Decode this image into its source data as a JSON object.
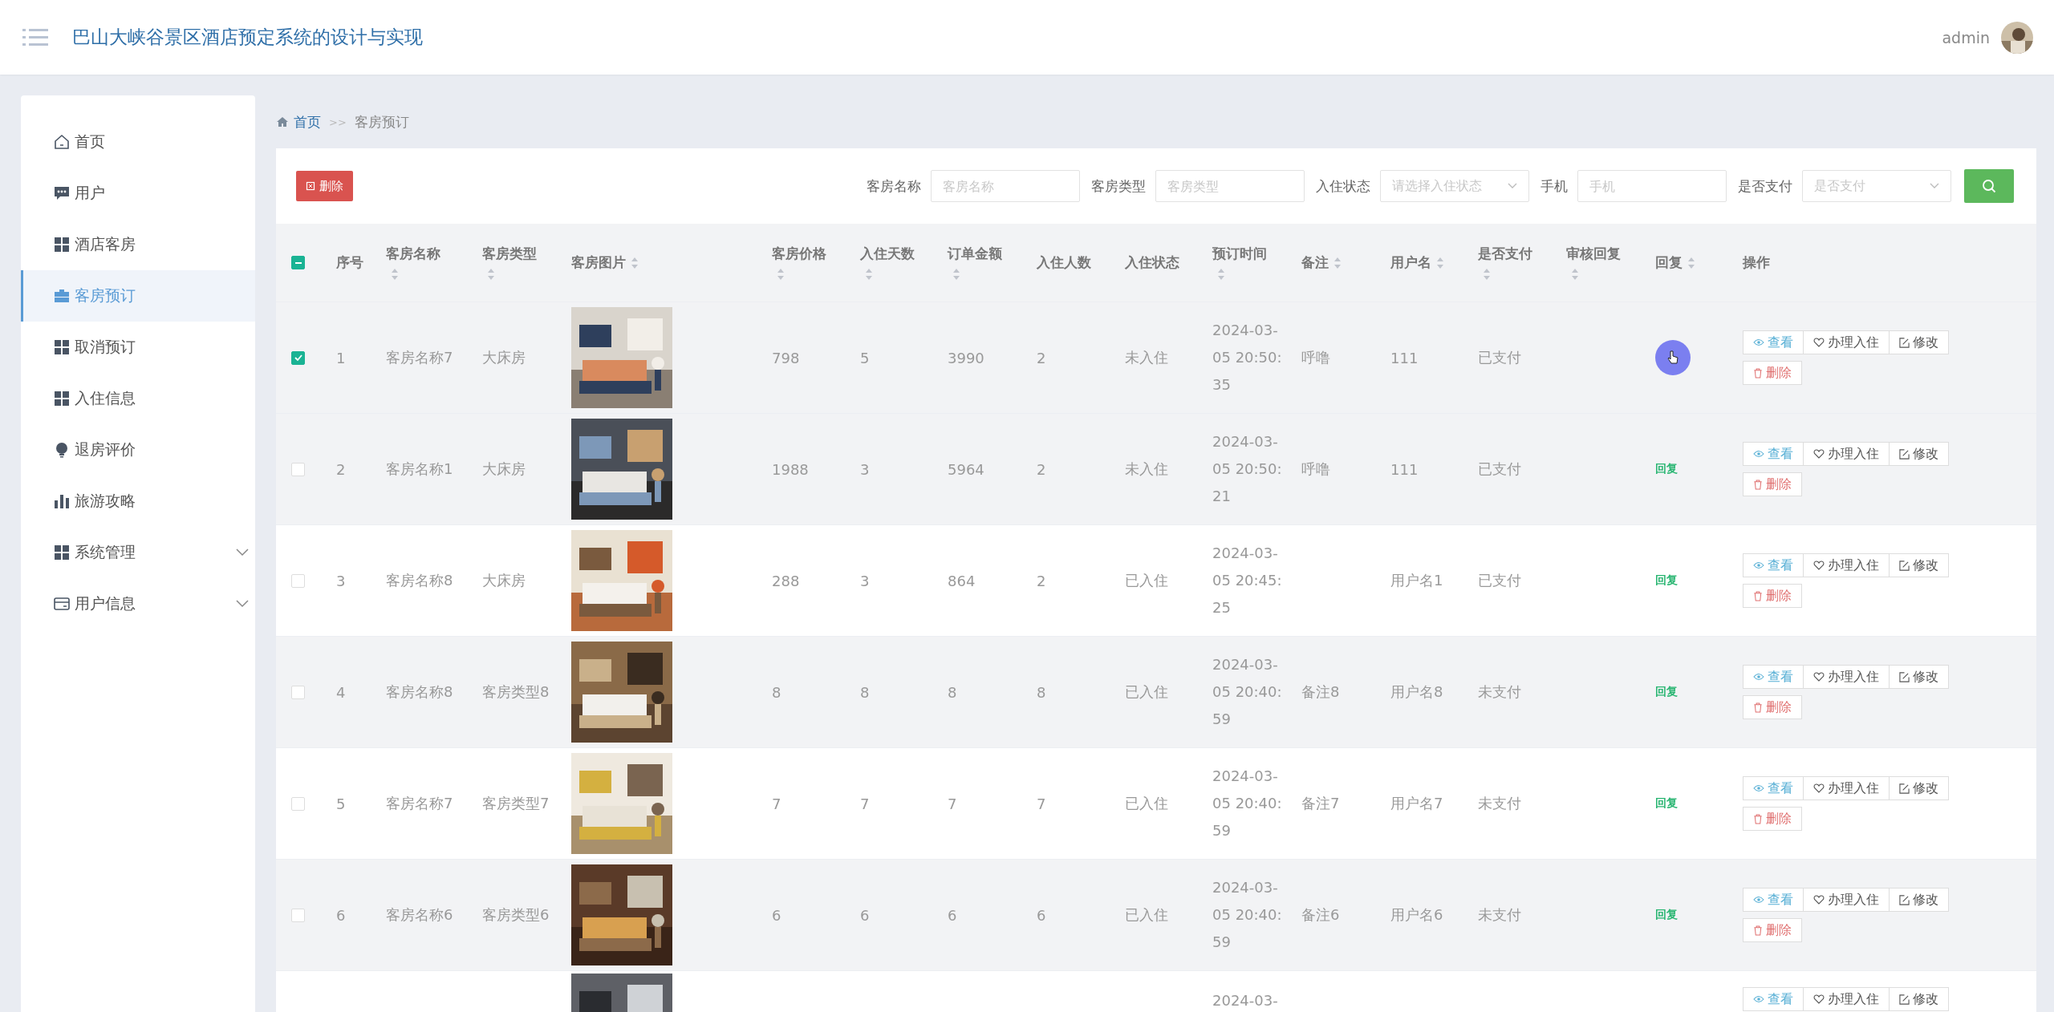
{
  "header": {
    "title": "巴山大峡谷景区酒店预定系统的设计与实现",
    "user": "admin"
  },
  "sidebar": {
    "items": [
      {
        "label": "首页",
        "kind": "home",
        "selected": false,
        "expandable": false
      },
      {
        "label": "用户",
        "kind": "chat",
        "selected": false,
        "expandable": false
      },
      {
        "label": "酒店客房",
        "kind": "grid",
        "selected": false,
        "expandable": false
      },
      {
        "label": "客房预订",
        "kind": "case",
        "selected": true,
        "expandable": false
      },
      {
        "label": "取消预订",
        "kind": "grid",
        "selected": false,
        "expandable": false
      },
      {
        "label": "入住信息",
        "kind": "grid",
        "selected": false,
        "expandable": false
      },
      {
        "label": "退房评价",
        "kind": "bulb",
        "selected": false,
        "expandable": false
      },
      {
        "label": "旅游攻略",
        "kind": "bars",
        "selected": false,
        "expandable": false
      },
      {
        "label": "系统管理",
        "kind": "grid",
        "selected": false,
        "expandable": true
      },
      {
        "label": "用户信息",
        "kind": "card",
        "selected": false,
        "expandable": true
      }
    ]
  },
  "breadcrumb": [
    "首页",
    "客房预订"
  ],
  "breadcrumb_separator": ">>",
  "toolbar": {
    "delete_button": "删除",
    "filters": [
      {
        "label": "客房名称",
        "kind": "input",
        "placeholder": "客房名称"
      },
      {
        "label": "客房类型",
        "kind": "input",
        "placeholder": "客房类型"
      },
      {
        "label": "入住状态",
        "kind": "select",
        "placeholder": "请选择入住状态"
      },
      {
        "label": "手机",
        "kind": "input",
        "placeholder": "手机"
      },
      {
        "label": "是否支付",
        "kind": "select",
        "placeholder": "是否支付"
      }
    ]
  },
  "table": {
    "select_all_indeterminate": true,
    "columns": [
      {
        "label": "序号",
        "kind": "plain"
      },
      {
        "label": "客房名称",
        "kind": "stacked"
      },
      {
        "label": "客房类型",
        "kind": "stacked"
      },
      {
        "label": "客房图片",
        "kind": "inline"
      },
      {
        "label": "客房价格",
        "kind": "stacked"
      },
      {
        "label": "入住天数",
        "kind": "stacked"
      },
      {
        "label": "订单金额",
        "kind": "stacked"
      },
      {
        "label": "入住人数",
        "kind": "plain"
      },
      {
        "label": "入住状态",
        "kind": "plain"
      },
      {
        "label": "预订时间",
        "kind": "stacked"
      },
      {
        "label": "备注",
        "kind": "inline"
      },
      {
        "label": "用户名",
        "kind": "inline"
      },
      {
        "label": "是否支付",
        "kind": "stacked"
      },
      {
        "label": "审核回复",
        "kind": "stacked"
      },
      {
        "label": "回复",
        "kind": "inline"
      },
      {
        "label": "操作",
        "kind": "plain"
      }
    ],
    "rows": [
      {
        "selected": true,
        "index": "1",
        "name": "客房名称7",
        "type": "大床房",
        "price": "798",
        "days": "5",
        "amount": "3990",
        "people": "2",
        "status": "未入住",
        "time": [
          "2024-03-",
          "05 20:50:",
          "35"
        ],
        "remark": "呼噜",
        "user": "111",
        "paid": "已支付",
        "hovered": true,
        "actions": [
          {
            "label": "查看",
            "kind": "view"
          },
          {
            "label": "办理入住",
            "kind": "checkin"
          },
          {
            "label": "修改",
            "kind": "edit"
          },
          {
            "label": "删除",
            "kind": "delete"
          }
        ]
      },
      {
        "selected": false,
        "index": "2",
        "name": "客房名称1",
        "type": "大床房",
        "price": "1988",
        "days": "3",
        "amount": "5964",
        "people": "2",
        "status": "未入住",
        "time": [
          "2024-03-",
          "05 20:50:",
          "21"
        ],
        "remark": "呼噜",
        "user": "111",
        "paid": "已支付",
        "reply": "回复",
        "hovered": false,
        "actions": [
          {
            "label": "查看",
            "kind": "view"
          },
          {
            "label": "办理入住",
            "kind": "checkin"
          },
          {
            "label": "修改",
            "kind": "edit"
          },
          {
            "label": "删除",
            "kind": "delete"
          }
        ]
      },
      {
        "selected": false,
        "index": "3",
        "name": "客房名称8",
        "type": "大床房",
        "price": "288",
        "days": "3",
        "amount": "864",
        "people": "2",
        "status": "已入住",
        "time": [
          "2024-03-",
          "05 20:45:",
          "25"
        ],
        "user": "用户名1",
        "paid": "已支付",
        "reply": "回复",
        "hovered": false,
        "actions": [
          {
            "label": "查看",
            "kind": "view"
          },
          {
            "label": "办理入住",
            "kind": "checkin"
          },
          {
            "label": "修改",
            "kind": "edit"
          },
          {
            "label": "删除",
            "kind": "delete"
          }
        ]
      },
      {
        "selected": false,
        "index": "4",
        "name": "客房名称8",
        "type": "客房类型8",
        "price": "8",
        "days": "8",
        "amount": "8",
        "people": "8",
        "status": "已入住",
        "time": [
          "2024-03-",
          "05 20:40:",
          "59"
        ],
        "remark": "备注8",
        "user": "用户名8",
        "paid": "未支付",
        "reply": "回复",
        "hovered": false,
        "actions": [
          {
            "label": "查看",
            "kind": "view"
          },
          {
            "label": "办理入住",
            "kind": "checkin"
          },
          {
            "label": "修改",
            "kind": "edit"
          },
          {
            "label": "删除",
            "kind": "delete"
          }
        ]
      },
      {
        "selected": false,
        "index": "5",
        "name": "客房名称7",
        "type": "客房类型7",
        "price": "7",
        "days": "7",
        "amount": "7",
        "people": "7",
        "status": "已入住",
        "time": [
          "2024-03-",
          "05 20:40:",
          "59"
        ],
        "remark": "备注7",
        "user": "用户名7",
        "paid": "未支付",
        "reply": "回复",
        "hovered": false,
        "actions": [
          {
            "label": "查看",
            "kind": "view"
          },
          {
            "label": "办理入住",
            "kind": "checkin"
          },
          {
            "label": "修改",
            "kind": "edit"
          },
          {
            "label": "删除",
            "kind": "delete"
          }
        ]
      },
      {
        "selected": false,
        "index": "6",
        "name": "客房名称6",
        "type": "客房类型6",
        "price": "6",
        "days": "6",
        "amount": "6",
        "people": "6",
        "status": "已入住",
        "time": [
          "2024-03-",
          "05 20:40:",
          "59"
        ],
        "remark": "备注6",
        "user": "用户名6",
        "paid": "未支付",
        "reply": "回复",
        "hovered": false,
        "actions": [
          {
            "label": "查看",
            "kind": "view"
          },
          {
            "label": "办理入住",
            "kind": "checkin"
          },
          {
            "label": "修改",
            "kind": "edit"
          },
          {
            "label": "删除",
            "kind": "delete"
          }
        ]
      },
      {
        "time": [
          "2024-03-"
        ],
        "actions": [
          {
            "label": "查看",
            "kind": "view"
          },
          {
            "label": "办理入住",
            "kind": "checkin"
          },
          {
            "label": "修改",
            "kind": "edit"
          }
        ]
      }
    ]
  }
}
